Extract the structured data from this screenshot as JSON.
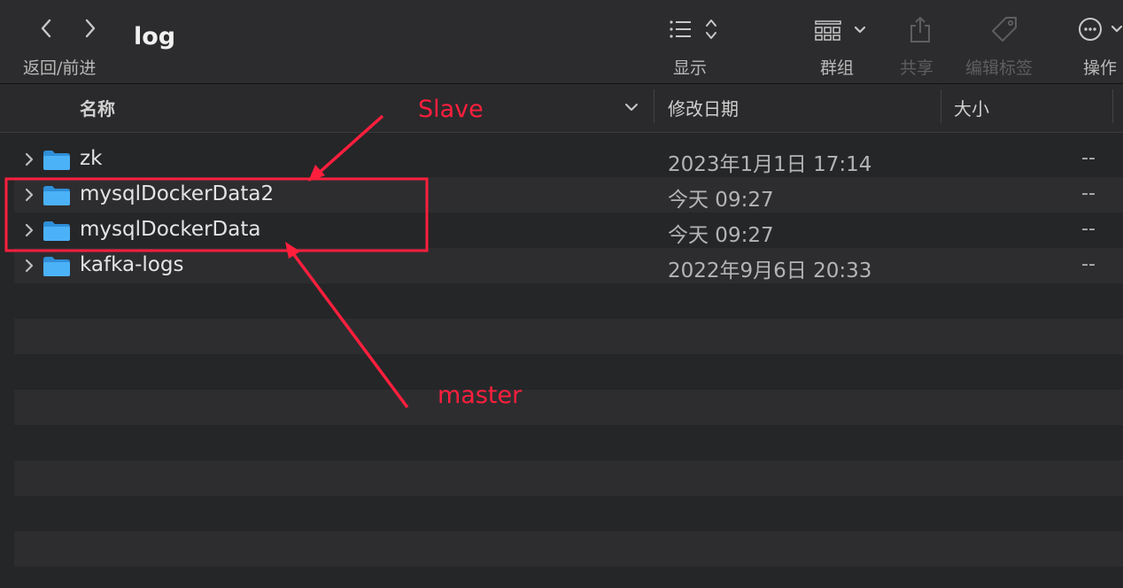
{
  "window": {
    "title": "log",
    "nav_label": "返回/前进"
  },
  "toolbar": {
    "display_label": "显示",
    "group_label": "群组",
    "share_label": "共享",
    "tags_label": "编辑标签",
    "actions_label": "操作",
    "icons": {
      "back": "chevron-left-icon",
      "forward": "chevron-right-icon",
      "display": "list-view-icon",
      "group": "grid-group-icon",
      "share": "share-icon",
      "tags": "tag-icon",
      "actions": "ellipsis-circle-icon"
    }
  },
  "columns": {
    "name": "名称",
    "date": "修改日期",
    "size": "大小"
  },
  "files": [
    {
      "name": "zk",
      "date": "2023年1月1日 17:14",
      "size": "--",
      "icon": "folder-icon"
    },
    {
      "name": "mysqlDockerData2",
      "date": "今天 09:27",
      "size": "--",
      "icon": "folder-icon"
    },
    {
      "name": "mysqlDockerData",
      "date": "今天 09:27",
      "size": "--",
      "icon": "folder-icon"
    },
    {
      "name": "kafka-logs",
      "date": "2022年9月6日 20:33",
      "size": "--",
      "icon": "folder-icon"
    }
  ],
  "annotations": {
    "slave_label": "Slave",
    "master_label": "master",
    "color": "#ff1f3d"
  },
  "colors": {
    "background": "#252628",
    "toolbar": "#2c2c2e",
    "folder": "#3fa7f2",
    "stripe": "#2d2d30"
  }
}
